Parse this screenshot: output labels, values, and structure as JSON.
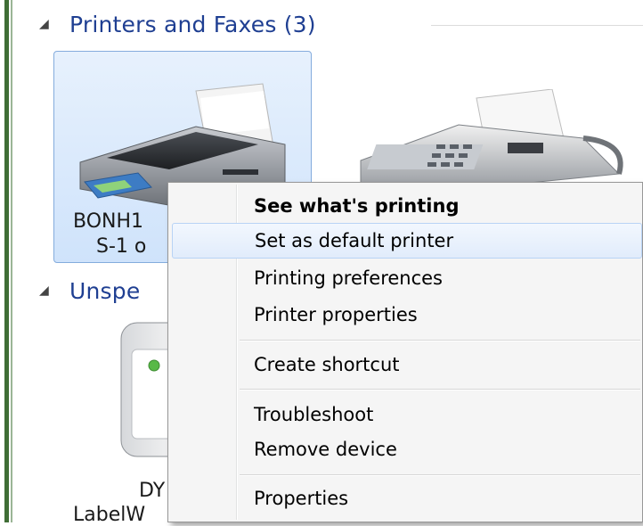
{
  "groups": {
    "printers_faxes": {
      "title": "Printers and Faxes (3)"
    },
    "unspecified": {
      "title": "Unspe"
    }
  },
  "devices": {
    "printer1": {
      "line1": "BONH1",
      "line2": "S-1 o"
    },
    "unspecified1": {
      "line1": "DY",
      "line2": "LabelW"
    }
  },
  "context_menu": {
    "items": [
      {
        "label": "See what's printing"
      },
      {
        "label": "Set as default printer"
      },
      {
        "label": "Printing preferences"
      },
      {
        "label": "Printer properties"
      },
      {
        "label": "Create shortcut"
      },
      {
        "label": "Troubleshoot"
      },
      {
        "label": "Remove device"
      },
      {
        "label": "Properties"
      }
    ]
  },
  "icons": {
    "group_toggle": "collapse-triangle-icon",
    "printer": "printer-icon",
    "fax": "fax-icon",
    "device": "device-icon"
  }
}
